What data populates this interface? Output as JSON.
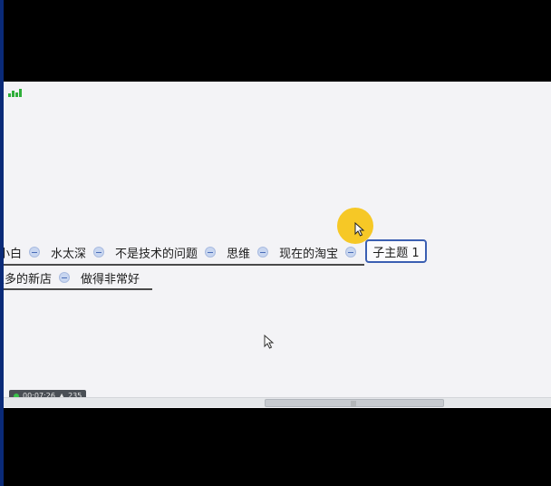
{
  "mindmap": {
    "row1": [
      "小白",
      "水太深",
      "不是技术的问题",
      "思维",
      "现在的淘宝"
    ],
    "selected_topic": "子主题 1",
    "row2": [
      "很多的新店",
      "做得非常好"
    ]
  },
  "status": {
    "timer": "00:07:26",
    "count": "235"
  },
  "colors": {
    "selection": "#3b5fb2",
    "cursor_highlight": "#f5c51a",
    "canvas": "#f3f3f6"
  }
}
